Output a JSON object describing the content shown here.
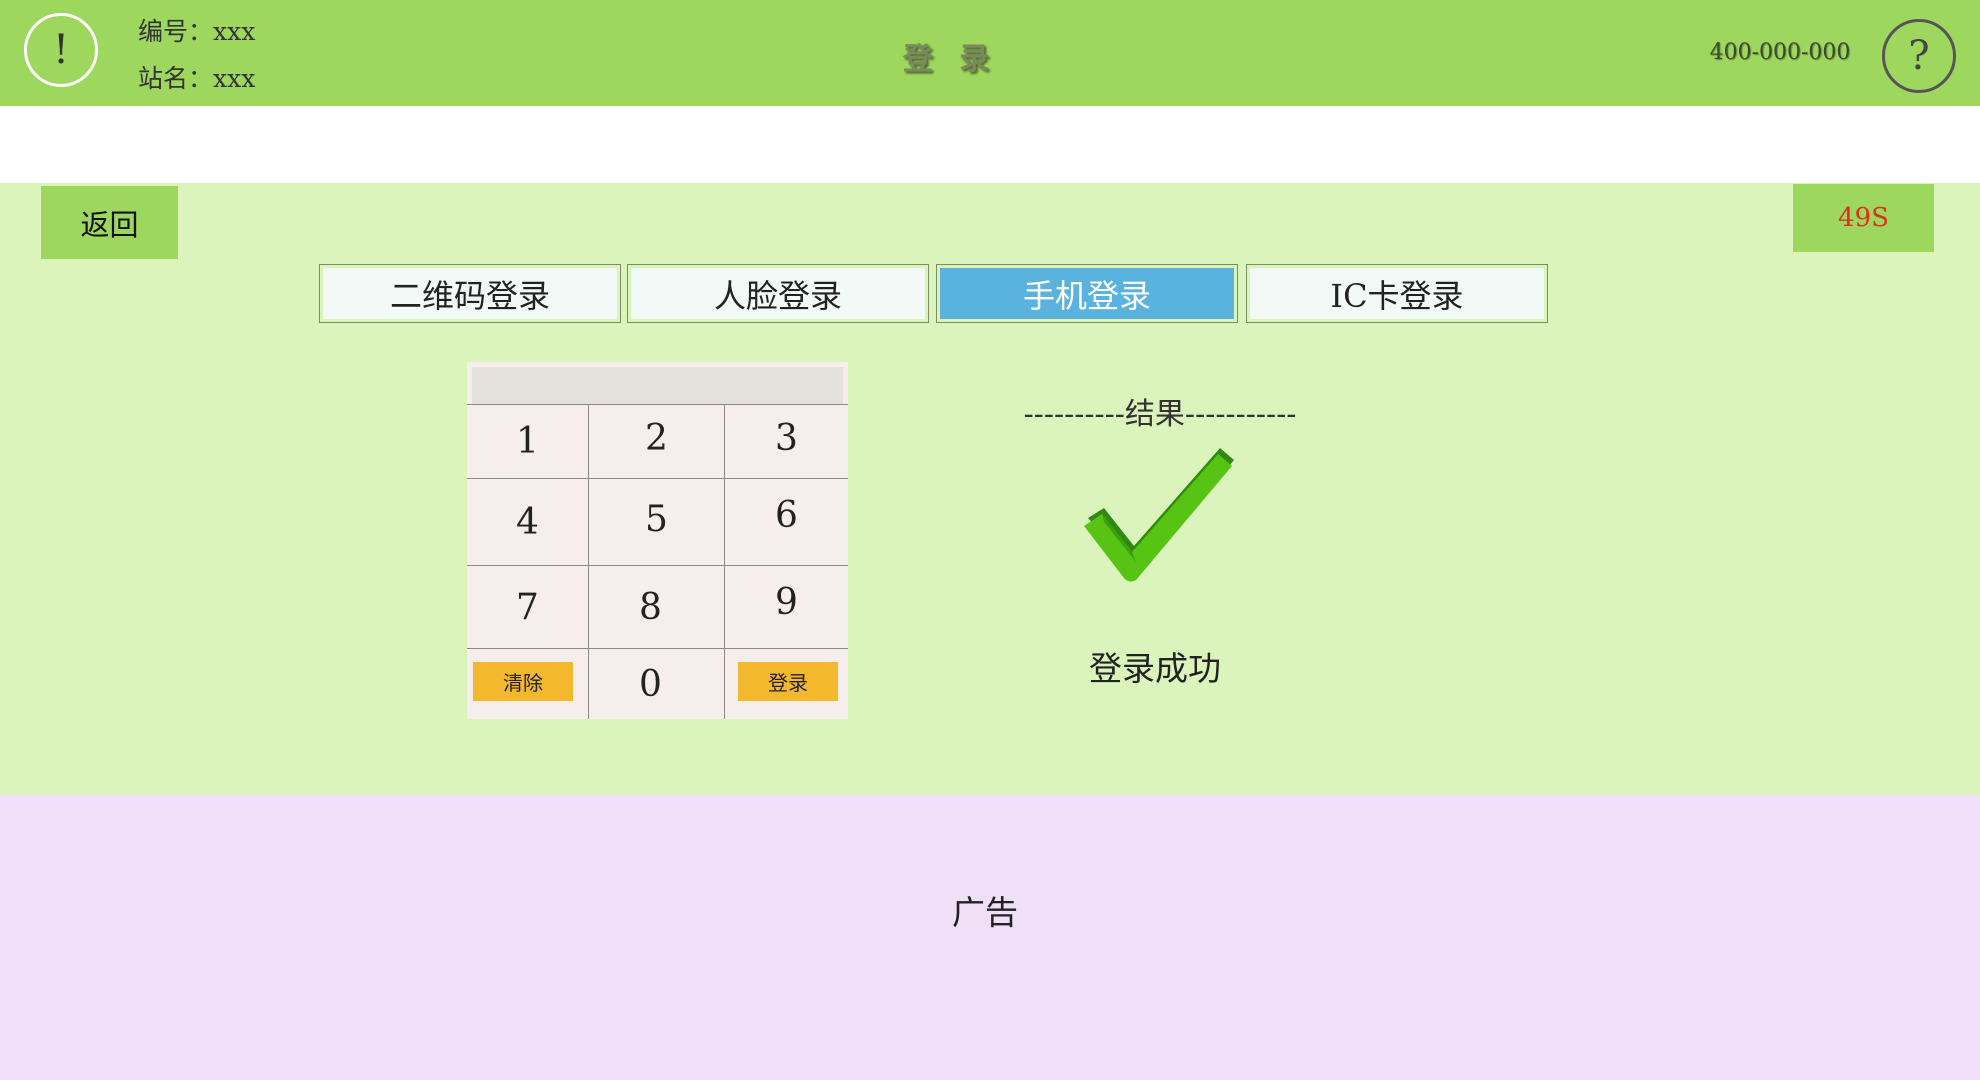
{
  "header": {
    "warning_icon": "!",
    "id_line": "编号：xxx",
    "station_line": "站名：xxx",
    "title": "登 录",
    "phone": "400-000-000",
    "help_icon": "?"
  },
  "nav": {
    "back_label": "返回",
    "countdown": "49S"
  },
  "tabs": [
    {
      "label": "二维码登录",
      "active": false
    },
    {
      "label": "人脸登录",
      "active": false
    },
    {
      "label": "手机登录",
      "active": true
    },
    {
      "label": "IC卡登录",
      "active": false
    }
  ],
  "keypad": {
    "display_value": "",
    "keys": [
      "1",
      "2",
      "3",
      "4",
      "5",
      "6",
      "7",
      "8",
      "9",
      "0"
    ],
    "clear_label": "清除",
    "login_label": "登录"
  },
  "result": {
    "heading": "----------结果-----------",
    "icon": "checkmark-icon",
    "message": "登录成功"
  },
  "ad": {
    "label": "广告"
  },
  "colors": {
    "header_green": "#9ed75d",
    "main_green": "#dbf4bc",
    "active_tab_blue": "#5ab3df",
    "button_yellow": "#f4b82e",
    "countdown_red": "#d9301f",
    "ad_purple": "#efe0f8"
  }
}
